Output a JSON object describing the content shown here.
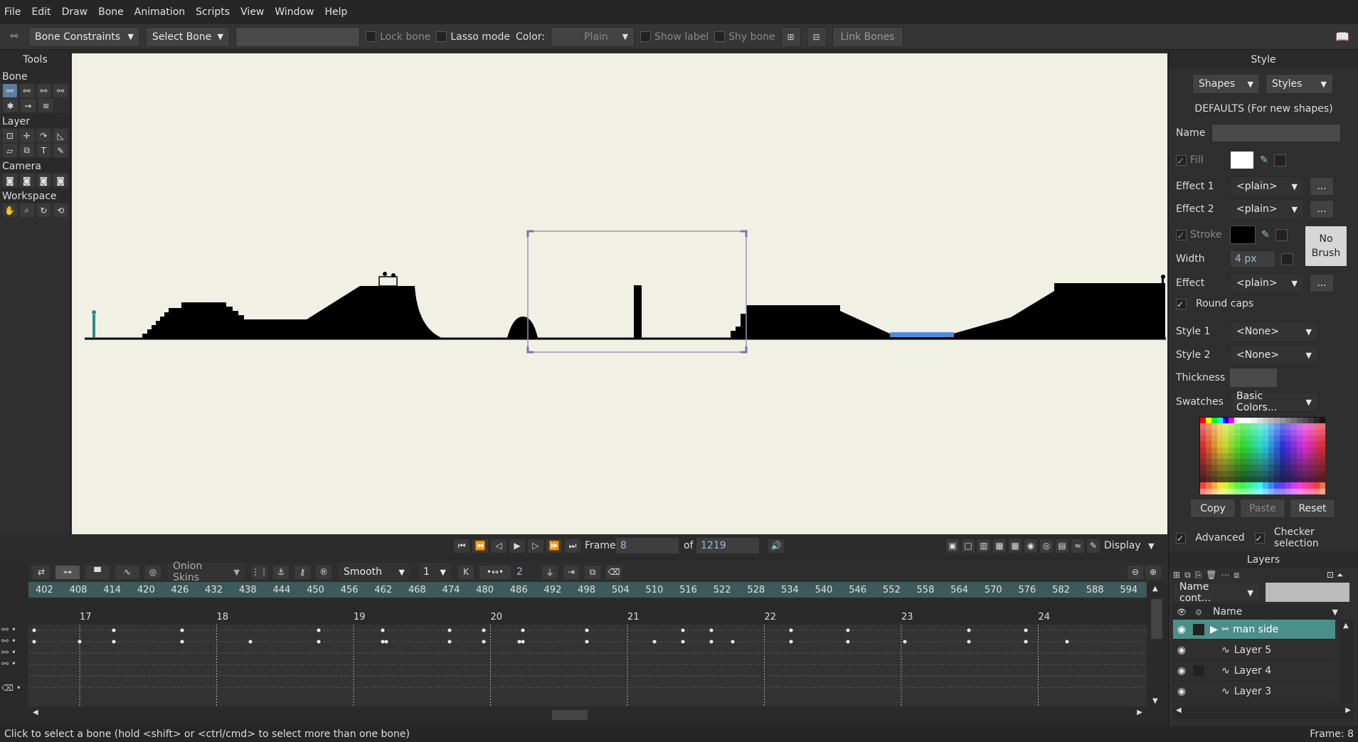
{
  "menu": [
    "File",
    "Edit",
    "Draw",
    "Bone",
    "Animation",
    "Scripts",
    "View",
    "Window",
    "Help"
  ],
  "toolbar": {
    "constraints_label": "Bone Constraints",
    "select_bone_label": "Select Bone",
    "lock_bone_label": "Lock bone",
    "lasso_label": "Lasso mode",
    "color_label": "Color:",
    "color_value": "Plain",
    "show_label": "Show label",
    "shy_bone_label": "Shy bone",
    "link_bones_label": "Link Bones"
  },
  "tools": {
    "title": "Tools",
    "sections": [
      "Bone",
      "Layer",
      "Camera",
      "Workspace"
    ]
  },
  "playback": {
    "frame_label": "Frame",
    "frame_value": "8",
    "of_label": "of",
    "total_frames": "1219",
    "display_label": "Display"
  },
  "timeline": {
    "onion_skins_label": "Onion Skins",
    "interp_label": "Smooth",
    "interp_count": "1",
    "keys_count": "2",
    "ruler_ticks": [
      "402",
      "408",
      "414",
      "420",
      "426",
      "432",
      "438",
      "444",
      "450",
      "456",
      "462",
      "468",
      "474",
      "480",
      "486",
      "492",
      "498",
      "504",
      "510",
      "516",
      "522",
      "528",
      "534",
      "540",
      "546",
      "552",
      "558",
      "564",
      "570",
      "576",
      "582",
      "588",
      "594"
    ],
    "second_marks": [
      "17",
      "18",
      "19",
      "20",
      "21",
      "22",
      "23",
      "24"
    ]
  },
  "style": {
    "title": "Style",
    "shapes_label": "Shapes",
    "styles_label": "Styles",
    "defaults_label": "DEFAULTS (For new shapes)",
    "name_label": "Name",
    "fill_label": "Fill",
    "effect1_label": "Effect 1",
    "effect1_value": "<plain>",
    "effect2_label": "Effect 2",
    "effect2_value": "<plain>",
    "stroke_label": "Stroke",
    "no_brush_label": "No\nBrush",
    "width_label": "Width",
    "width_value": "4 px",
    "effect_label": "Effect",
    "effect_value": "<plain>",
    "ellipsis": "...",
    "round_caps_label": "Round caps",
    "style1_label": "Style 1",
    "style1_value": "<None>",
    "style2_label": "Style 2",
    "style2_value": "<None>",
    "thickness_label": "Thickness",
    "swatches_label": "Swatches",
    "swatches_value": "Basic Colors...",
    "copy_label": "Copy",
    "paste_label": "Paste",
    "reset_label": "Reset",
    "advanced_label": "Advanced",
    "checker_label": "Checker selection",
    "fill_color": "#ffffff",
    "stroke_color": "#000000"
  },
  "layers": {
    "title": "Layers",
    "filter_label": "Name cont...",
    "name_header": "Name",
    "items": [
      "man side",
      "Layer 5",
      "Layer 4",
      "Layer 3"
    ]
  },
  "status": {
    "hint": "Click to select a bone (hold <shift> or <ctrl/cmd> to select more than one bone)",
    "frame_readout": "Frame: 8"
  }
}
